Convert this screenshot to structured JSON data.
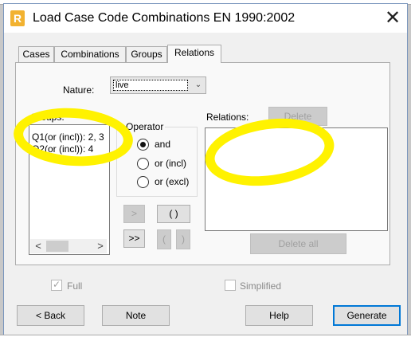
{
  "window": {
    "title": "Load Case Code Combinations EN 1990:2002",
    "close_glyph": "✕",
    "app_icon_letter": "R"
  },
  "tabs": [
    {
      "label": "Cases",
      "active": false
    },
    {
      "label": "Combinations",
      "active": false
    },
    {
      "label": "Groups",
      "active": false
    },
    {
      "label": "Relations",
      "active": true
    }
  ],
  "nature": {
    "label": "Nature:",
    "selected": "live",
    "arrow_glyph": "⌄"
  },
  "groups": {
    "label": "Groups:",
    "items": [
      "Q1(or (incl)): 2, 3",
      "Q2(or (incl)): 4"
    ],
    "scroll_left_glyph": "<",
    "scroll_right_glyph": ">"
  },
  "operator": {
    "label": "Operator",
    "options": [
      {
        "label": "and",
        "checked": true
      },
      {
        "label": "or (incl)",
        "checked": false
      },
      {
        "label": "or (excl)",
        "checked": false
      }
    ]
  },
  "middle_buttons": {
    "add": ">",
    "add_all": ">>",
    "paren_pair": "( )",
    "open_paren": "(",
    "close_paren": ")"
  },
  "relations": {
    "label": "Relations:",
    "delete_label": "Delete",
    "delete_all_label": "Delete all"
  },
  "options": {
    "full_label": "Full",
    "full_checked": true,
    "simplified_label": "Simplified",
    "simplified_checked": false,
    "check_glyph": "✓"
  },
  "footer": {
    "back_label": "< Back",
    "note_label": "Note",
    "help_label": "Help",
    "generate_label": "Generate"
  },
  "colors": {
    "highlight": "#fff200",
    "accent": "#0078d7"
  }
}
